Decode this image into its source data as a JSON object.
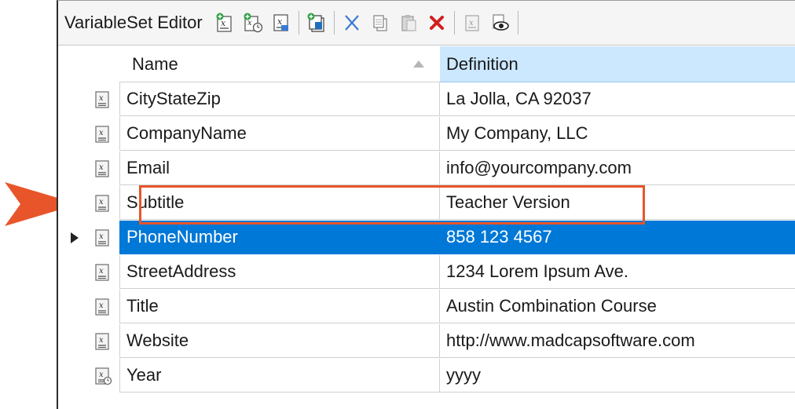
{
  "toolbar": {
    "title": "VariableSet Editor",
    "buttons": [
      {
        "icon": "add-variable-icon"
      },
      {
        "icon": "add-datetime-variable-icon"
      },
      {
        "icon": "edit-variable-icon"
      },
      {
        "icon": "add-variable-set-icon"
      },
      {
        "icon": "cut-icon"
      },
      {
        "icon": "copy-icon"
      },
      {
        "icon": "paste-icon"
      },
      {
        "icon": "delete-icon"
      },
      {
        "icon": "variable-icon"
      },
      {
        "icon": "preview-icon"
      }
    ]
  },
  "grid": {
    "columns": {
      "name": "Name",
      "definition": "Definition"
    },
    "sort": {
      "column": "Name",
      "direction": "ascending"
    },
    "rows": [
      {
        "name": "CityStateZip",
        "definition": "La Jolla, CA 92037",
        "icon": "text-variable-icon"
      },
      {
        "name": "CompanyName",
        "definition": "My Company, LLC",
        "icon": "text-variable-icon"
      },
      {
        "name": "Email",
        "definition": "info@yourcompany.com",
        "icon": "text-variable-icon"
      },
      {
        "name": "Subtitle",
        "definition": "Teacher Version",
        "icon": "text-variable-icon"
      },
      {
        "name": "PhoneNumber",
        "definition": "858 123 4567",
        "icon": "text-variable-icon",
        "selected": true
      },
      {
        "name": "StreetAddress",
        "definition": "1234 Lorem Ipsum Ave.",
        "icon": "text-variable-icon"
      },
      {
        "name": "Title",
        "definition": "Austin Combination Course",
        "icon": "text-variable-icon"
      },
      {
        "name": "Website",
        "definition": "http://www.madcapsoftware.com",
        "icon": "text-variable-icon"
      },
      {
        "name": "Year",
        "definition": "yyyy",
        "icon": "datetime-variable-icon"
      }
    ]
  },
  "annotation": {
    "highlighted_row": "Subtitle",
    "highlight_color": "#e8552a",
    "pointer_color": "#e8552a"
  },
  "colors": {
    "selection": "#0078d7",
    "header_active": "#cce8ff"
  }
}
